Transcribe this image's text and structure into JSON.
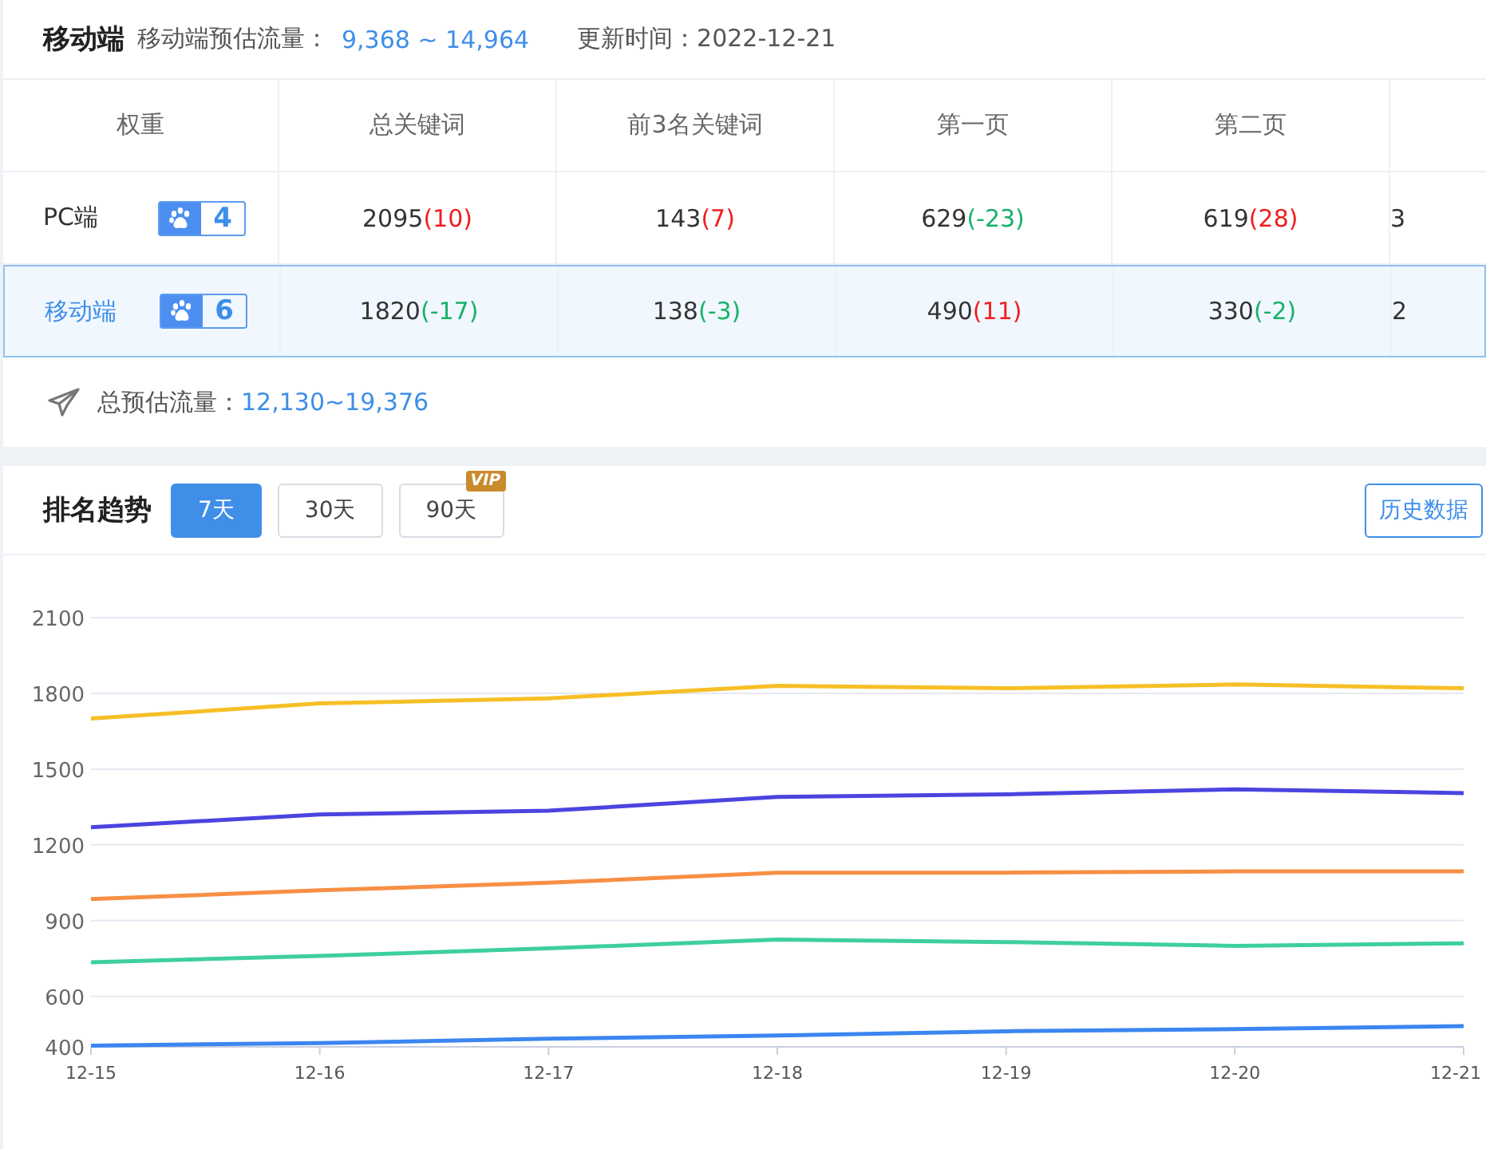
{
  "summary": {
    "title": "移动端",
    "traffic_label": "移动端预估流量：",
    "traffic_value": "9,368 ~ 14,964",
    "updated": "更新时间：2022-12-21"
  },
  "table": {
    "columns": [
      "权重",
      "总关键词",
      "前3名关键词",
      "第一页",
      "第二页"
    ],
    "rows": [
      {
        "selected": false,
        "cells": [
          {
            "name": "PC端",
            "weight": "4"
          },
          {
            "value": "2095",
            "change": "(10)",
            "color": "#f01e1e"
          },
          {
            "value": "143",
            "change": "(7)",
            "color": "#f01e1e"
          },
          {
            "value": "629",
            "change": "(-23)",
            "color": "#17b26a"
          },
          {
            "value": "619",
            "change": "(28)",
            "color": "#f01e1e"
          },
          {
            "value": "3"
          }
        ]
      },
      {
        "selected": true,
        "cells": [
          {
            "name": "移动端",
            "weight": "6"
          },
          {
            "value": "1820",
            "change": "(-17)",
            "color": "#17b26a"
          },
          {
            "value": "138",
            "change": "(-3)",
            "color": "#17b26a"
          },
          {
            "value": "490",
            "change": "(11)",
            "color": "#f01e1e"
          },
          {
            "value": "330",
            "change": "(-2)",
            "color": "#17b26a"
          },
          {
            "value": "2"
          }
        ]
      }
    ]
  },
  "total": {
    "label": "总预估流量：",
    "value": "12,130~19,376"
  },
  "trend": {
    "title": "排名趋势",
    "ranges": [
      {
        "label": "7天",
        "selected": true
      },
      {
        "label": "30天",
        "selected": false
      },
      {
        "label": "90天",
        "selected": false,
        "badge": "VIP"
      }
    ],
    "history_button": "历史数据",
    "chart_data": {
      "type": "line",
      "grid": true,
      "categories": [
        "12-15",
        "12-16",
        "12-17",
        "12-18",
        "12-19",
        "12-20",
        "12-21"
      ],
      "ylim": [
        400,
        2100
      ],
      "yticks": [
        400,
        600,
        900,
        1200,
        1500,
        1800,
        2100
      ],
      "series": [
        {
          "color": "#f6bf26",
          "values": [
            1700,
            1760,
            1780,
            1830,
            1820,
            1835,
            1820
          ]
        },
        {
          "color": "#4b44e0",
          "values": [
            1270,
            1320,
            1335,
            1390,
            1400,
            1420,
            1405
          ]
        },
        {
          "color": "#f78f45",
          "values": [
            985,
            1020,
            1050,
            1090,
            1090,
            1095,
            1095
          ]
        },
        {
          "color": "#3ecf9e",
          "values": [
            735,
            760,
            790,
            825,
            815,
            800,
            810
          ]
        },
        {
          "color": "#3b86f0",
          "values": [
            405,
            415,
            432,
            445,
            462,
            470,
            482
          ]
        }
      ]
    }
  }
}
